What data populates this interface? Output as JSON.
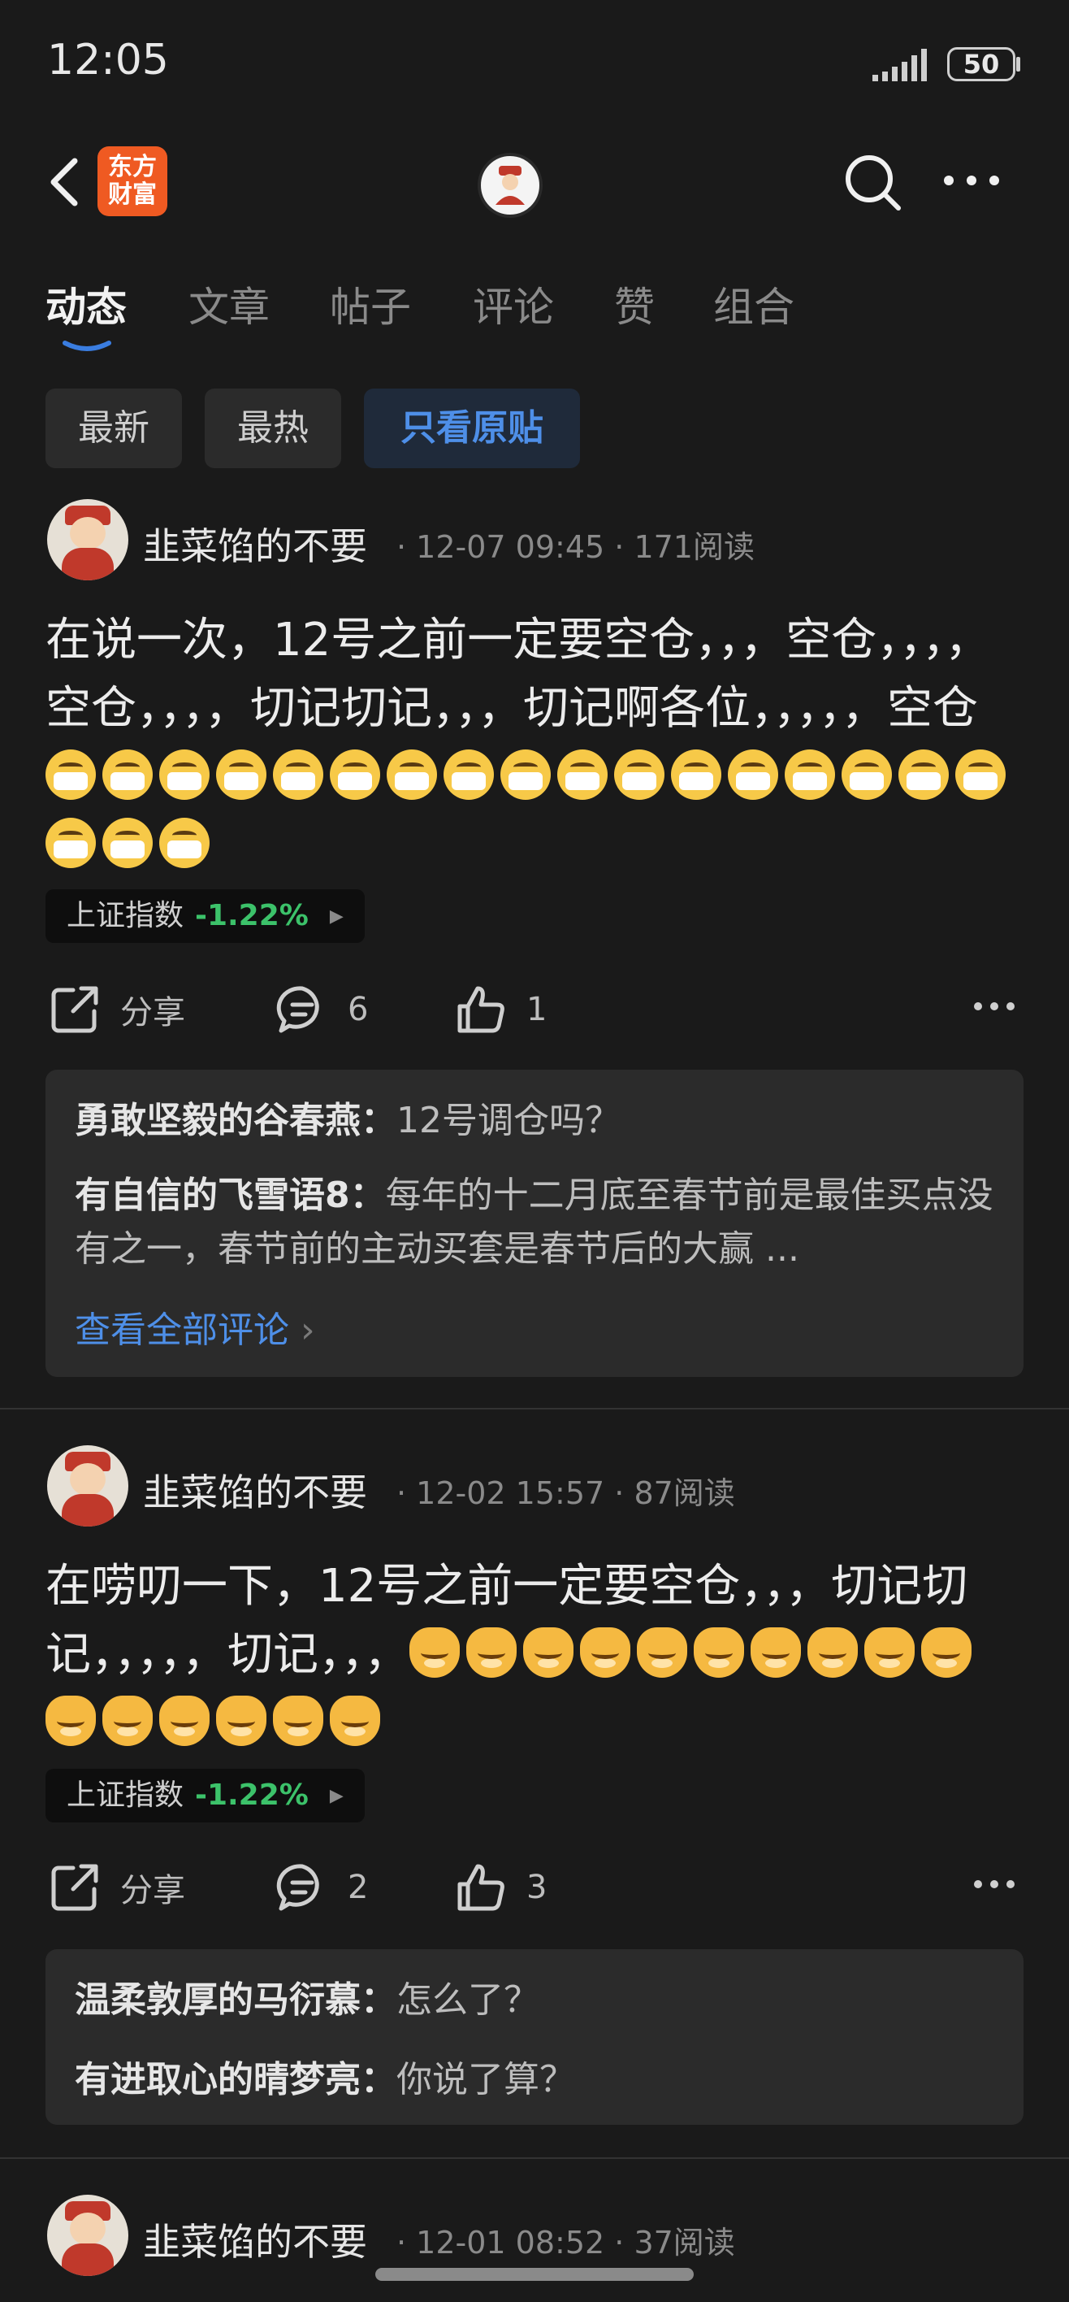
{
  "status_bar": {
    "time": "12:05",
    "battery": "50"
  },
  "nav": {
    "logo_line1": "东方",
    "logo_line2": "财富"
  },
  "tabs": [
    {
      "label": "动态",
      "active": true
    },
    {
      "label": "文章",
      "active": false
    },
    {
      "label": "帖子",
      "active": false
    },
    {
      "label": "评论",
      "active": false
    },
    {
      "label": "赞",
      "active": false
    },
    {
      "label": "组合",
      "active": false
    }
  ],
  "filters": [
    {
      "label": "最新",
      "active": false
    },
    {
      "label": "最热",
      "active": false
    },
    {
      "label": "只看原贴",
      "active": true
    }
  ],
  "posts": [
    {
      "author": "韭菜馅的不要",
      "date": "12-07 09:45",
      "reads": "171阅读",
      "text": "在说一次，12号之前一定要空仓，，，空仓，，，，空仓，，，，切记切记，，，切记啊各位，，，，，空仓",
      "emoji": "mask-emoji",
      "emoji_count": 20,
      "index_name": "上证指数",
      "index_change": "-1.22%",
      "share_label": "分享",
      "comment_count": "6",
      "like_count": "1",
      "comments": [
        {
          "name": "勇敢坚毅的谷春燕",
          "text": "12号调仓吗？"
        },
        {
          "name": "有自信的飞雪语8",
          "text": "每年的十二月底至春节前是最佳买点没有之一，春节前的主动买套是春节后的大赢 ..."
        }
      ],
      "view_all": "查看全部评论"
    },
    {
      "author": "韭菜馅的不要",
      "date": "12-02 15:57",
      "reads": "87阅读",
      "text": "在唠叨一下，12号之前一定要空仓，，，切记切记，，，，，切记，，，",
      "emoji": "cat-emoji",
      "emoji_count": 16,
      "index_name": "上证指数",
      "index_change": "-1.22%",
      "share_label": "分享",
      "comment_count": "2",
      "like_count": "3",
      "comments": [
        {
          "name": "温柔敦厚的马衍慕",
          "text": "怎么了？"
        },
        {
          "name": "有进取心的晴梦亮",
          "text": "你说了算？"
        }
      ]
    },
    {
      "author": "韭菜馅的不要",
      "date": "12-01 08:52",
      "reads": "37阅读"
    }
  ],
  "colors": {
    "background": "#1a1a1a",
    "accent_blue": "#4e8fe8",
    "positive_green": "#3cc26a",
    "logo_orange": "#ef5a22"
  },
  "icons": [
    "back-arrow-icon",
    "search-icon",
    "more-icon",
    "share-icon",
    "comment-icon",
    "like-icon",
    "signal-icon",
    "battery-icon"
  ]
}
